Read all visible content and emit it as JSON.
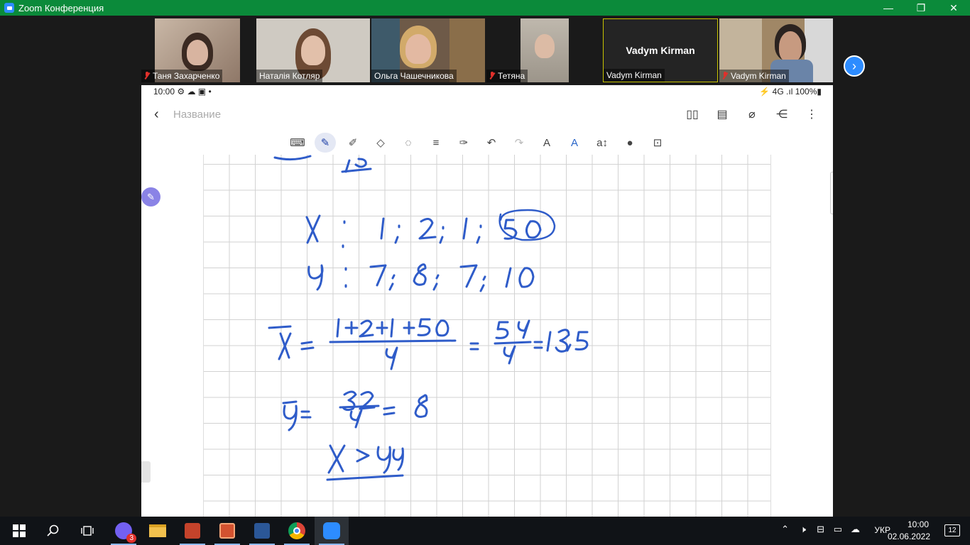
{
  "window": {
    "title": "Zoom Конференция",
    "minimize": "—",
    "restore": "❐",
    "close": "✕"
  },
  "participants": [
    {
      "name": "Таня Захарченко",
      "muted": true
    },
    {
      "name": "Наталія Котляр",
      "muted": false
    },
    {
      "name": "Ольга Чашечникова",
      "muted": false
    },
    {
      "name": "Тетяна",
      "muted": true
    },
    {
      "name": "Vadym Kirman",
      "muted": false,
      "avatar_text": "Vadym Kirman"
    },
    {
      "name": "Vadym Kirman",
      "muted": true
    }
  ],
  "next_icon": "chevron-right-icon",
  "phone": {
    "status_left": "10:00 ⚙ ☁ ▣ •",
    "status_right": "⚡ 4G .ıl 100%▮",
    "title_placeholder": "Название",
    "handwriting_text": [
      "X : 1; 2; 1; 50",
      "y : 7; 8; 7; 10",
      "X̄ = (1+2+1+50)/4 = 54/4 = 13,5",
      "ȳ = 32/4 = 8",
      "X > y"
    ]
  },
  "taskbar": {
    "viber_badge": "3",
    "language": "УКР",
    "time": "10:00",
    "date": "02.06.2022",
    "notifications": "12"
  },
  "colors": {
    "titlebar": "#0b8a3a",
    "ink": "#2f5cc9",
    "accent": "#2d8cff"
  }
}
